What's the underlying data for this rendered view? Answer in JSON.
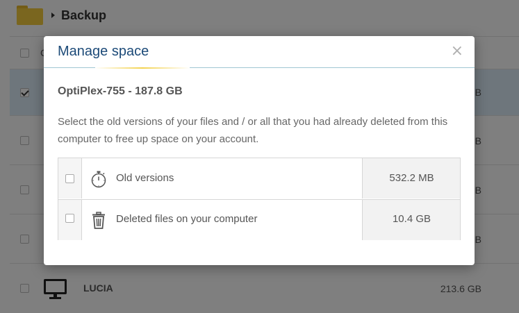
{
  "background": {
    "breadcrumb": "Backup",
    "column_header_initial": "C",
    "rows": [
      {
        "checked": false,
        "size": ""
      },
      {
        "checked": true,
        "size": "GB"
      },
      {
        "checked": false,
        "size": "MB"
      },
      {
        "checked": false,
        "size": "MB"
      },
      {
        "checked": false,
        "size": "MB"
      },
      {
        "checked": false,
        "name": "LUCIA",
        "size": "213.6 GB"
      }
    ]
  },
  "modal": {
    "title": "Manage space",
    "close_label": "×",
    "computer": "OptiPlex-755 - 187.8 GB",
    "description": "Select the old versions of your files and / or all that you had already deleted from this computer to free up space on your account.",
    "options": [
      {
        "label": "Old versions",
        "size": "532.2 MB",
        "icon": "stopwatch-icon",
        "checked": false
      },
      {
        "label": "Deleted files on your computer",
        "size": "10.4 GB",
        "icon": "trash-icon",
        "checked": false
      }
    ]
  }
}
